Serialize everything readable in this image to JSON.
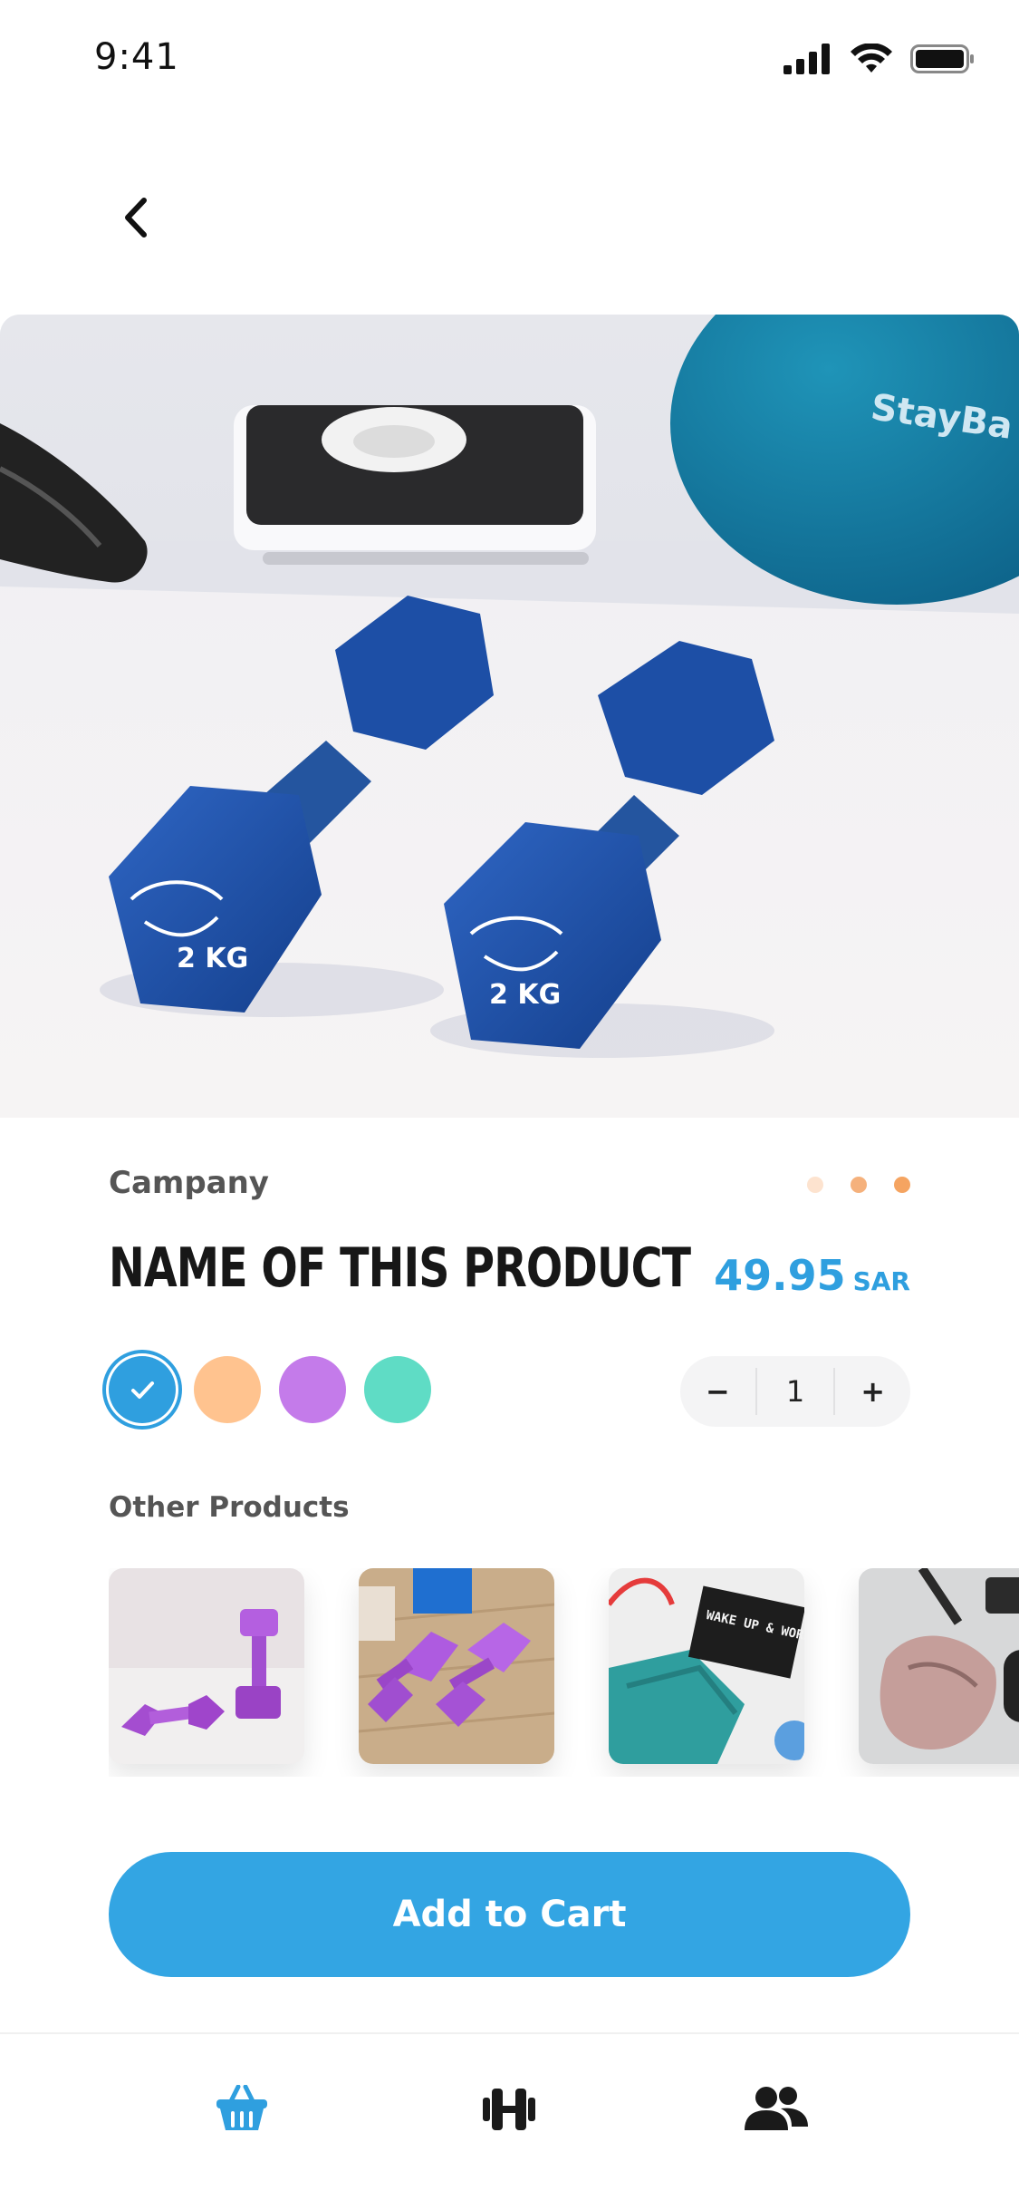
{
  "status_bar": {
    "time": "9:41"
  },
  "product": {
    "company": "Campany",
    "name": "NAME OF THIS PRODUCT",
    "price": "49.95",
    "currency": "SAR",
    "hero_image_text": [
      "2 KG",
      "2 KG",
      "StayBa"
    ],
    "gallery_dots": {
      "count": 3,
      "active_index": 2,
      "colors": [
        "#fde3cf",
        "#f5b17c",
        "#f5a461"
      ]
    }
  },
  "colors": {
    "options": [
      "#2f9fdf",
      "#ffc38f",
      "#c47bea",
      "#5fdcc5"
    ],
    "selected_index": 0
  },
  "quantity": {
    "minus": "−",
    "value": "1",
    "plus": "+"
  },
  "other_products": {
    "title": "Other Products",
    "items": [
      {
        "icon": "purple-dumbbells-image"
      },
      {
        "icon": "purple-dumbbells-on-wood-image"
      },
      {
        "icon": "resistance-band-image",
        "sign_text": "WAKE UP & WORKOUT"
      },
      {
        "icon": "sneakers-image"
      }
    ]
  },
  "actions": {
    "add_to_cart": "Add to Cart"
  },
  "tab_bar": {
    "tabs": [
      {
        "icon": "basket-icon",
        "active": true
      },
      {
        "icon": "dumbbell-icon",
        "active": false
      },
      {
        "icon": "users-icon",
        "active": false
      }
    ],
    "active_color": "#2f9fdf",
    "inactive_color": "#1a1a1a"
  }
}
